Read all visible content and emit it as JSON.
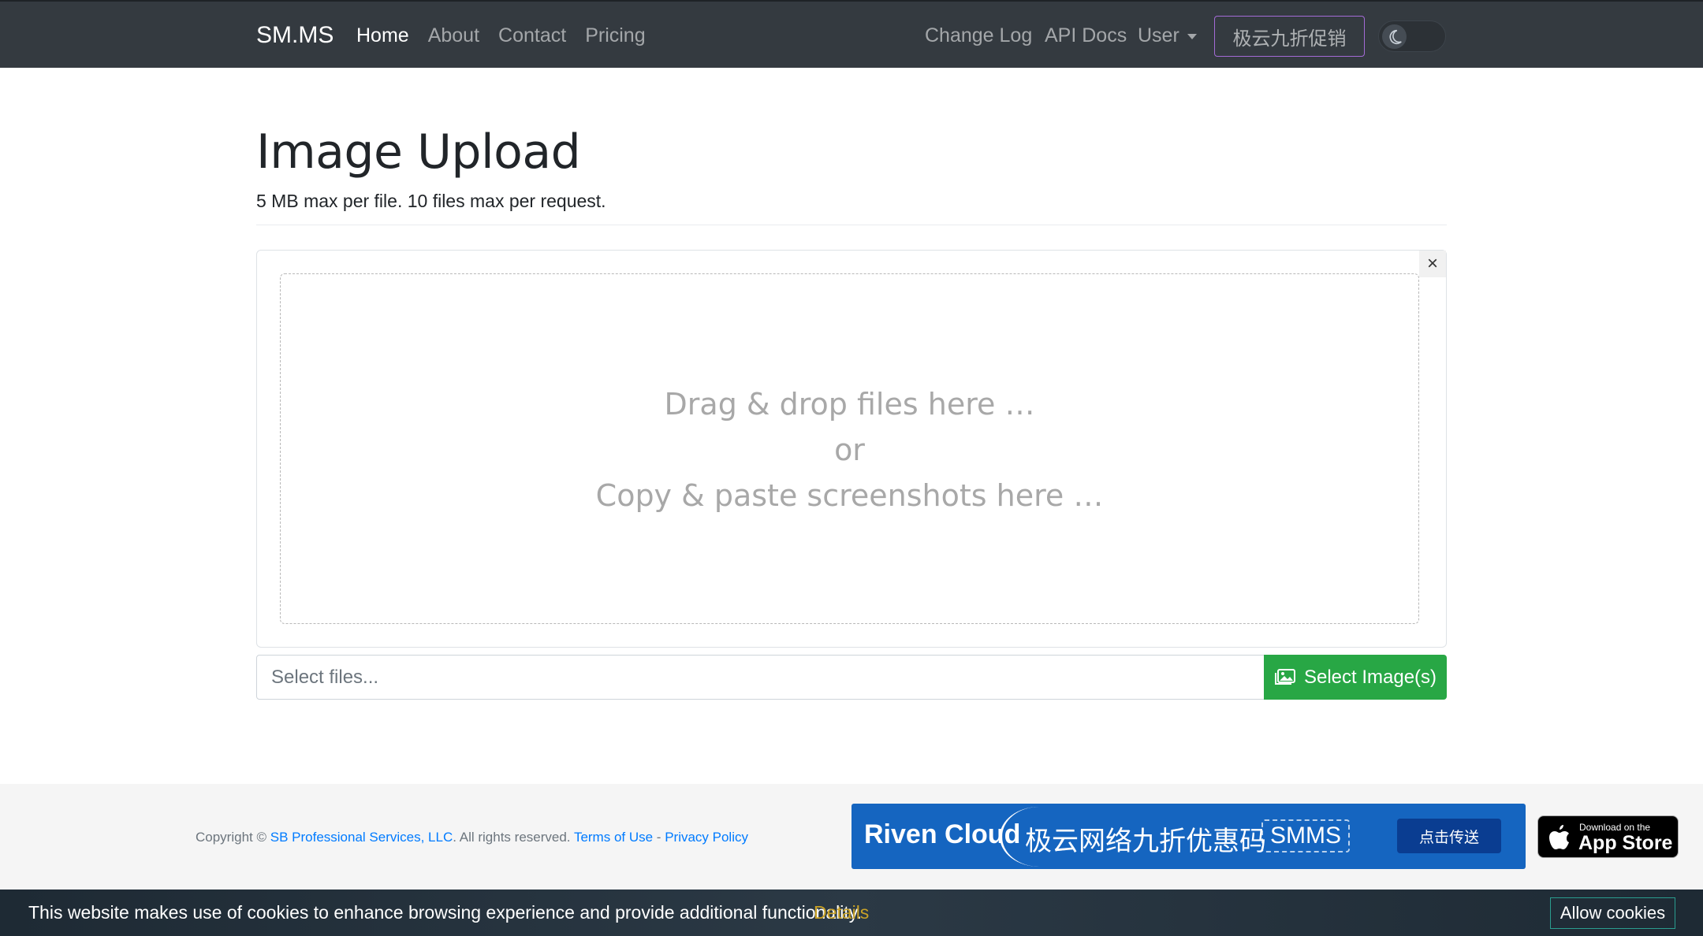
{
  "nav": {
    "brand": "SM.MS",
    "left_links": [
      "Home",
      "About",
      "Contact",
      "Pricing"
    ],
    "right_links": [
      "Change Log",
      "API Docs",
      "User"
    ],
    "promo_button": "极云九折促销",
    "theme_toggle_icon": "moon-icon"
  },
  "page": {
    "title": "Image Upload",
    "subtitle": "5 MB max per file. 10 files max per request."
  },
  "dropzone": {
    "line1": "Drag & drop files here …",
    "line2": "or",
    "line3": "Copy & paste screenshots here …",
    "close_symbol": "×"
  },
  "file_input": {
    "placeholder": "Select files...",
    "button_label": "Select Image(s)",
    "button_icon": "images-icon",
    "button_color": "#28a745"
  },
  "footer": {
    "copyright_prefix": "Copyright © ",
    "company": "SB Professional Services, LLC",
    "rights": ". All rights reserved. ",
    "terms": "Terms of Use",
    "separator": " - ",
    "privacy": "Privacy Policy",
    "banner": {
      "logo": "Riven Cloud",
      "text": "极云网络九折优惠码",
      "code": "SMMS",
      "button": "点击传送"
    },
    "appstore": {
      "small": "Download on the",
      "big": "App Store"
    }
  },
  "cookie": {
    "message": "This website makes use of cookies to enhance browsing experience and provide additional functionality.",
    "details": "Details",
    "allow": "Allow cookies"
  }
}
